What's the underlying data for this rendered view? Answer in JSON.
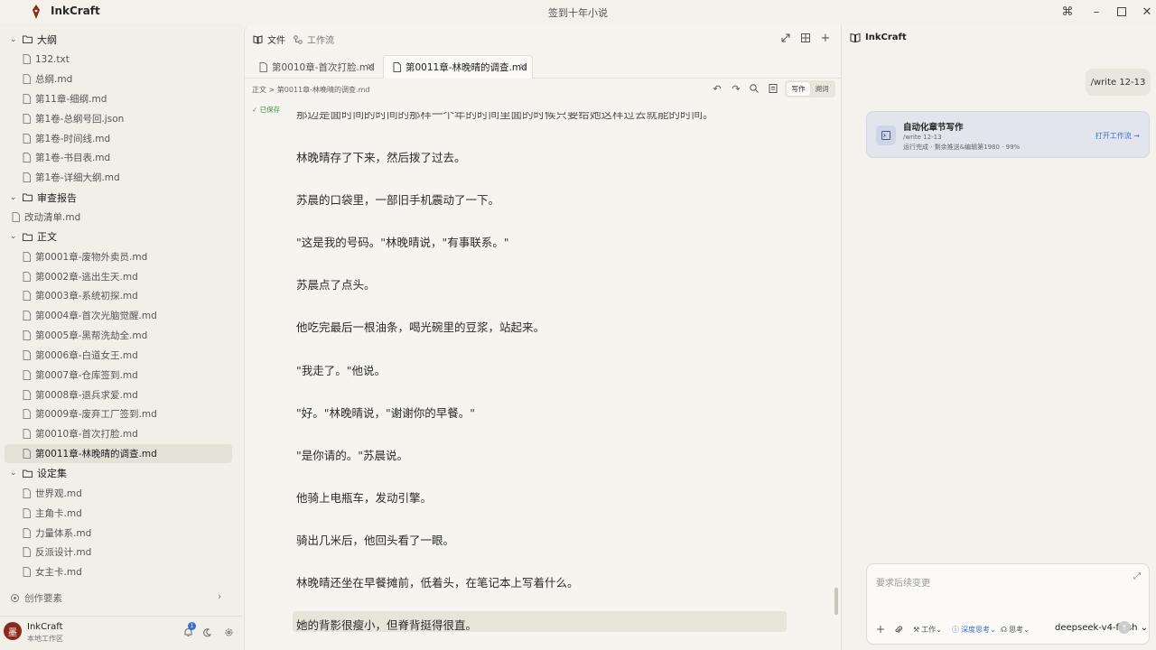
{
  "app": {
    "name": "InkCraft",
    "window_title": "签到十年小说"
  },
  "sidebar": {
    "tree": [
      {
        "kind": "folder",
        "label": "大纲",
        "chevron": "expanded"
      },
      {
        "kind": "file",
        "label": "132.txt"
      },
      {
        "kind": "file",
        "label": "总纲.md"
      },
      {
        "kind": "file",
        "label": "第11章-细纲.md"
      },
      {
        "kind": "file",
        "label": "第1卷-总纲号回.json"
      },
      {
        "kind": "file",
        "label": "第1卷-时间线.md"
      },
      {
        "kind": "file",
        "label": "第1卷-书目表.md"
      },
      {
        "kind": "file",
        "label": "第1卷-详细大纲.md"
      },
      {
        "kind": "folder",
        "label": "审查报告",
        "chevron": "expanded"
      },
      {
        "kind": "root",
        "label": "改动清单.md"
      },
      {
        "kind": "folder",
        "label": "正文",
        "chevron": "expanded"
      },
      {
        "kind": "file",
        "label": "第0001章-废物外卖员.md"
      },
      {
        "kind": "file",
        "label": "第0002章-逃出生天.md"
      },
      {
        "kind": "file",
        "label": "第0003章-系统初探.md"
      },
      {
        "kind": "file",
        "label": "第0004章-首次光脑觉醒.md"
      },
      {
        "kind": "file",
        "label": "第0005章-黑帮洗劫全.md"
      },
      {
        "kind": "file",
        "label": "第0006章-白道女王.md"
      },
      {
        "kind": "file",
        "label": "第0007章-仓库签到.md"
      },
      {
        "kind": "file",
        "label": "第0008章-退兵求爱.md"
      },
      {
        "kind": "file",
        "label": "第0009章-废弃工厂签到.md"
      },
      {
        "kind": "file",
        "label": "第0010章-首次打脸.md"
      },
      {
        "kind": "file",
        "label": "第0011章-林晚晴的调查.md",
        "active": true
      },
      {
        "kind": "folder",
        "label": "设定集",
        "chevron": "expanded"
      },
      {
        "kind": "file",
        "label": "世界观.md"
      },
      {
        "kind": "file",
        "label": "主角卡.md"
      },
      {
        "kind": "file",
        "label": "力量体系.md"
      },
      {
        "kind": "file",
        "label": "反派设计.md"
      },
      {
        "kind": "file",
        "label": "女主卡.md"
      }
    ],
    "elements_label": "创作要素",
    "user": {
      "avatar_char": "墨",
      "name": "InkCraft",
      "workspace": "本地工作区"
    },
    "notification_count": "1"
  },
  "editor": {
    "top_tabs": {
      "files": "文件",
      "workflow": "工作流"
    },
    "doc_tabs": [
      {
        "label": "第0010章-首次打脸.md",
        "active": false
      },
      {
        "label": "第0011章-林晚晴的调查.md",
        "active": true
      }
    ],
    "breadcrumb": "正文 > 第0011章-林晚晴的调查.md",
    "mode": {
      "write": "写作",
      "preview": "溯词"
    },
    "saved_status": "已保存",
    "cut_line": "那边是面时间的时间的那样一个年的时间里面的时候只要给她这样过去就能的时间。",
    "paragraphs": [
      "林晚晴存了下来，然后拨了过去。",
      "苏晨的口袋里，一部旧手机震动了一下。",
      "\"这是我的号码。\"林晚晴说，\"有事联系。\"",
      "苏晨点了点头。",
      "他吃完最后一根油条，喝光碗里的豆浆，站起来。",
      "\"我走了。\"他说。",
      "\"好。\"林晚晴说，\"谢谢你的早餐。\"",
      "\"是你请的。\"苏晨说。",
      "他骑上电瓶车，发动引擎。",
      "骑出几米后，他回头看了一眼。",
      "林晚晴还坐在早餐摊前，低着头，在笔记本上写着什么。",
      "她的背影很瘦小，但脊背挺得很直。"
    ]
  },
  "chat": {
    "title": "InkCraft",
    "user_message": "/write 12-13",
    "tool_card": {
      "title": "自动化章节写作",
      "command": "/write 12-13",
      "status": "运行完成 · 剩余推送&编辑第1980 · 99%",
      "open_label": "打开工作流 →"
    },
    "composer": {
      "placeholder": "要求后续变更",
      "work_label": "工作",
      "deep_think_label": "深度思考",
      "reference_label": "思考",
      "model": "deepseek-v4-flash"
    }
  },
  "colors": {
    "accent": "#3a6fd8",
    "brand_red": "#8b2a1c",
    "saved_green": "#4a8f4a"
  }
}
